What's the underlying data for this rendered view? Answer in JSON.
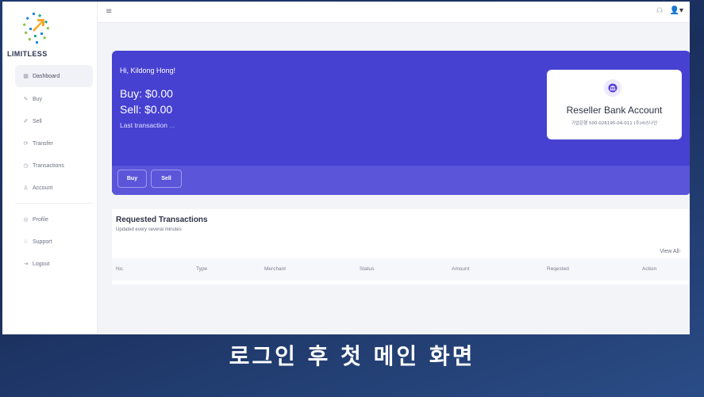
{
  "brand": {
    "name": "LIMITLESS"
  },
  "sidebar": {
    "items": [
      {
        "label": "Dashboard",
        "icon": "dashboard-icon",
        "glyph": "▦",
        "active": true
      },
      {
        "label": "Buy",
        "icon": "buy-icon",
        "glyph": "✎",
        "active": false
      },
      {
        "label": "Sell",
        "icon": "sell-icon",
        "glyph": "✐",
        "active": false
      },
      {
        "label": "Transfer",
        "icon": "transfer-icon",
        "glyph": "⟳",
        "active": false
      },
      {
        "label": "Transactions",
        "icon": "history-icon",
        "glyph": "◷",
        "active": false
      },
      {
        "label": "Account",
        "icon": "account-icon",
        "glyph": "♙",
        "active": false
      },
      {
        "label": "Profile",
        "icon": "profile-icon",
        "glyph": "◎",
        "active": false
      },
      {
        "label": "Support",
        "icon": "support-icon",
        "glyph": "♘",
        "active": false
      },
      {
        "label": "Logout",
        "icon": "logout-icon",
        "glyph": "⇥",
        "active": false
      }
    ]
  },
  "topbar": {
    "menu_glyph": "≡",
    "notify_glyph": "☊",
    "user_glyph": "👤▾"
  },
  "hero": {
    "greeting": "Hi, Kildong Hong!",
    "buy_text": "Buy: $0.00",
    "sell_text": "Sell: $0.00",
    "last_tx_label": "Last transaction",
    "last_tx_value": "...",
    "buy_button": "Buy",
    "sell_button": "Sell"
  },
  "bank_card": {
    "title": "Reseller Bank Account",
    "account": "기업은행 500-026195-04-011 (주)씨스나인"
  },
  "requested": {
    "title": "Requested Transactions",
    "subtitle": "Updated every several minutes",
    "view_all": "View All",
    "columns": [
      "No.",
      "Type",
      "Merchant",
      "Status",
      "Amount",
      "Reqested",
      "Action"
    ]
  },
  "caption": "로그인 후 첫 메인 화면",
  "colors": {
    "primary": "#4641d1",
    "primary_light": "#5a55d9"
  }
}
